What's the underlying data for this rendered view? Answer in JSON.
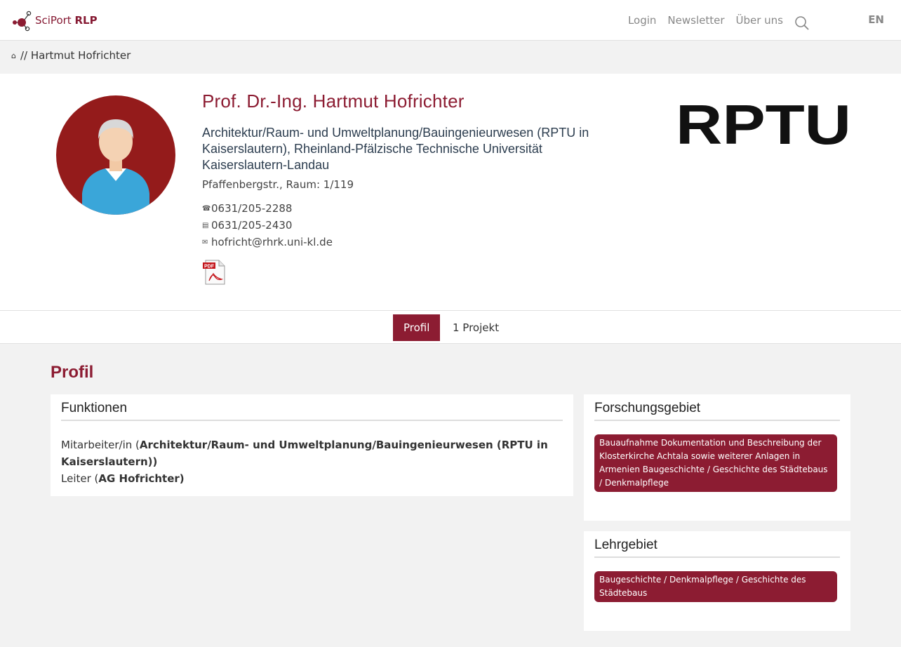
{
  "header": {
    "brand_prefix": "SciPort",
    "brand_suffix": "RLP",
    "nav": [
      "Login",
      "Newsletter",
      "Über uns"
    ],
    "language": "EN"
  },
  "breadcrumb": {
    "separator": "//",
    "current": "Hartmut Hofrichter"
  },
  "profile": {
    "name": "Prof. Dr.-Ing. Hartmut Hofrichter",
    "organization": "Architektur/Raum- und Umweltplanung/Bauingenieurwesen (RPTU in Kaiserslautern), Rheinland-Pfälzische Technische Universität Kaiserslautern-Landau",
    "address": "Pfaffenbergstr., Raum: 1/119",
    "phone": "0631/205-2288",
    "fax": "0631/205-2430",
    "email": "hofricht@rhrk.uni-kl.de",
    "institution_logo_text": "RPTU"
  },
  "tabs": [
    {
      "label": "Profil",
      "active": true
    },
    {
      "label": "1 Projekt",
      "active": false
    }
  ],
  "section": {
    "title": "Profil"
  },
  "funktionen": {
    "heading": "Funktionen",
    "line1_prefix": "Mitarbeiter/in (",
    "line1_bold": "Architektur/Raum- und Umweltplanung/Bauingenieurwesen (RPTU in Kaiserslautern))",
    "line2_prefix": "Leiter (",
    "line2_bold": "AG Hofrichter)"
  },
  "forschungsgebiet": {
    "heading": "Forschungsgebiet",
    "tag": "Bauaufnahme Dokumentation und Beschreibung der Klosterkirche Achtala sowie weiterer Anlagen in Armenien Baugeschichte / Geschichte des Städtebaus / Denkmalpflege"
  },
  "lehrgebiet": {
    "heading": "Lehrgebiet",
    "tag": "Baugeschichte / Denkmalpflege / Geschichte des Städtebaus"
  },
  "colors": {
    "accent": "#8c1c32",
    "avatar_bg": "#941b1b"
  },
  "icons": [
    "sciport-logo-icon",
    "search-icon",
    "home-icon",
    "phone-icon",
    "fax-icon",
    "email-icon",
    "pdf-icon"
  ]
}
